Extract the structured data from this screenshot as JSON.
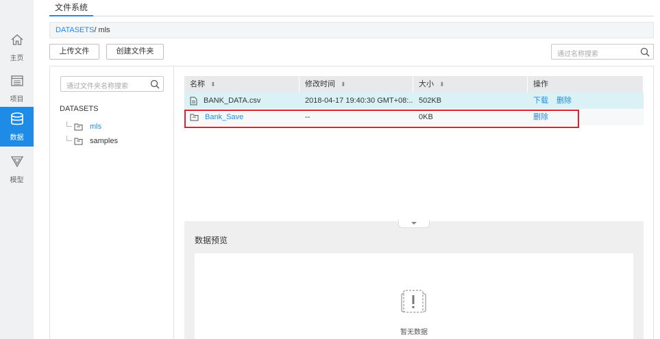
{
  "sidenav": {
    "items": [
      {
        "label": "主页",
        "icon": "home-icon"
      },
      {
        "label": "项目",
        "icon": "project-list-icon"
      },
      {
        "label": "数据",
        "icon": "database-icon",
        "active": true
      },
      {
        "label": "模型",
        "icon": "model-funnel-icon"
      }
    ],
    "active_color": "#1e8ce6"
  },
  "header": {
    "tab": "文件系统"
  },
  "breadcrumb": {
    "root": "DATASETS",
    "current": "/ mls"
  },
  "toolbar": {
    "upload_label": "上传文件",
    "create_folder_label": "创建文件夹",
    "search_placeholder": "通过名称搜索"
  },
  "folder_panel": {
    "search_placeholder": "通过文件夹名称搜索",
    "root": "DATASETS",
    "folders": [
      {
        "name": "mls",
        "active": true
      },
      {
        "name": "samples",
        "active": false
      }
    ]
  },
  "file_table": {
    "columns": [
      "名称",
      "修改时间",
      "大小",
      "操作"
    ],
    "rows": [
      {
        "name": "BANK_DATA.csv",
        "type": "file",
        "modified": "2018-04-17 19:40:30 GMT+08:...",
        "size": "502KB",
        "actions": [
          "下载",
          "删除"
        ]
      },
      {
        "name": "Bank_Save",
        "type": "folder",
        "modified": "--",
        "size": "0KB",
        "actions": [
          "删除"
        ]
      }
    ]
  },
  "preview": {
    "title": "数据预览",
    "empty_text": "暂无数据"
  },
  "colors": {
    "accent": "#1e8ce6",
    "highlight_border": "#e0202a",
    "selected_row": "#daf2f5"
  }
}
